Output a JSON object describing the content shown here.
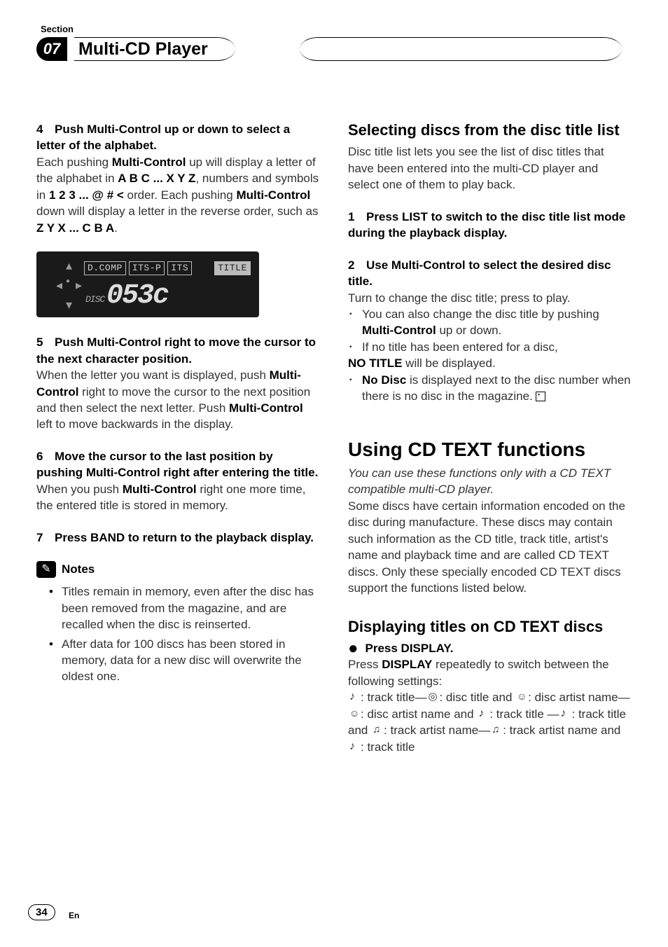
{
  "header": {
    "section_label": "Section",
    "number": "07",
    "title": "Multi-CD Player"
  },
  "left": {
    "step4": {
      "num": "4",
      "title": "Push Multi-Control up or down to select a letter of the alphabet.",
      "body_a": "Each pushing ",
      "mc1": "Multi-Control",
      "body_b": " up will display a letter of the alphabet in ",
      "seq1": "A B C ... X Y Z",
      "body_c": ", numbers and symbols in ",
      "seq2": "1 2 3 ... @ # <",
      "body_d": " order. Each pushing ",
      "mc2": "Multi-Control",
      "body_e": " down will display a letter in the reverse order, such as ",
      "seq3": "Z Y X ... C B A",
      "body_f": "."
    },
    "display": {
      "chips": [
        "D.COMP",
        "ITS-P",
        "ITS",
        "TITLE"
      ],
      "disc_label": "DISC",
      "big": "053c"
    },
    "step5": {
      "num": "5",
      "title": "Push Multi-Control right to move the cursor to the next character position.",
      "body_a": "When the letter you want is displayed, push ",
      "mc1": "Multi-Control",
      "body_b": " right to move the cursor to the next position and then select the next letter. Push ",
      "mc2": "Multi-Control",
      "body_c": " left to move backwards in the display."
    },
    "step6": {
      "num": "6",
      "title": "Move the cursor to the last position by pushing Multi-Control right after entering the title.",
      "body_a": "When you push ",
      "mc1": "Multi-Control",
      "body_b": " right one more time, the entered title is stored in memory."
    },
    "step7": {
      "num": "7",
      "title": "Press BAND to return to the playback display."
    },
    "notes": {
      "label": "Notes",
      "items": [
        "Titles remain in memory, even after the disc has been removed from the magazine, and are recalled when the disc is reinserted.",
        "After data for 100 discs has been stored in memory, data for a new disc will overwrite the oldest one."
      ]
    }
  },
  "right": {
    "sec1": {
      "heading": "Selecting discs from the disc title list",
      "intro": "Disc title list lets you see the list of disc titles that have been entered into the multi-CD player and select one of them to play back.",
      "step1": {
        "num": "1",
        "title": "Press LIST to switch to the disc title list mode during the playback display."
      },
      "step2": {
        "num": "2",
        "title": "Use Multi-Control to select the desired disc title.",
        "line1": "Turn to change the disc title; press to play.",
        "b1_a": "You can also change the disc title by pushing ",
        "b1_mc": "Multi-Control",
        "b1_b": " up or down.",
        "b2_a": "If no title has been entered for a disc, ",
        "b2_nt": "NO TITLE",
        "b2_b": " will be displayed.",
        "b3_nd": "No Disc",
        "b3_a": " is displayed next to the disc number when there is no disc in the magazine."
      }
    },
    "sec2": {
      "heading": "Using CD TEXT functions",
      "intro_i": "You can use these functions only with a CD TEXT compatible multi-CD player.",
      "intro": "Some discs have certain information encoded on the disc during manufacture. These discs may contain such information as the CD title, track title, artist's name and playback time and are called CD TEXT discs. Only these specially encoded CD TEXT discs support the functions listed below."
    },
    "sec3": {
      "heading": "Displaying titles on CD TEXT discs",
      "step_title": "Press DISPLAY.",
      "body_a": "Press ",
      "disp": "DISPLAY",
      "body_b": " repeatedly to switch between the following settings:",
      "seq": {
        "p1": ": track title—",
        "p2": ": disc title and ",
        "p3": ": disc artist name—",
        "p4": ": disc artist name and ",
        "p5": ": track title —",
        "p6": ": track title and ",
        "p7": ": track artist name—",
        "p8": ": track artist name and ",
        "p9": ": track title"
      }
    }
  },
  "footer": {
    "page": "34",
    "lang": "En"
  }
}
